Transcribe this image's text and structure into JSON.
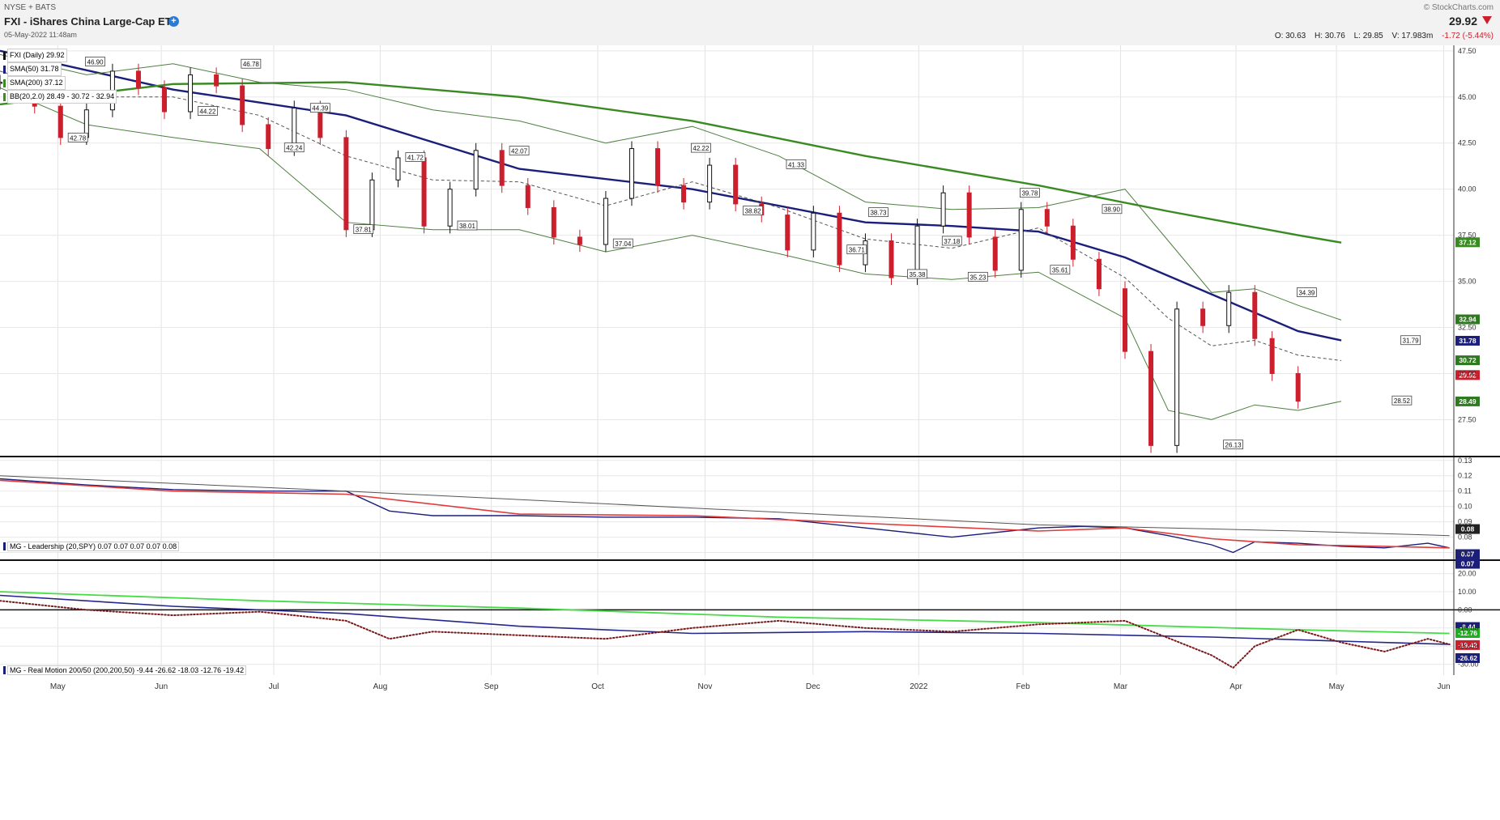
{
  "header": {
    "exchange": "NYSE + BATS",
    "title": "FXI - iShares China Large-Cap ETF",
    "date": "05-May-2022 11:48am",
    "watermark": "© StockCharts.com",
    "last": "29.92",
    "open": "O: 30.63",
    "high": "H: 30.76",
    "low": "L: 29.85",
    "volume": "V: 17.983m",
    "change": "-1.72 (-5.44%)"
  },
  "legend": {
    "price": "FXI (Daily) 29.92",
    "sma50": "SMA(50) 31.78",
    "sma200": "SMA(200) 37.12",
    "bb": "BB(20,2.0) 28.49 - 30.72 - 32.94"
  },
  "panel2": {
    "label": "MG - Leadership (20,SPY) 0.07 0.07 0.07 0.07 0.08"
  },
  "panel3": {
    "label": "MG - Real Motion 200/50 (200,200,50) -9.44 -26.62 -18.03 -12.76 -19.42"
  },
  "x_axis": {
    "months": [
      "May",
      "Jun",
      "Jul",
      "Aug",
      "Sep",
      "Oct",
      "Nov",
      "Dec",
      "2022",
      "Feb",
      "Mar",
      "Apr",
      "May",
      "Jun"
    ]
  },
  "colors": {
    "price_up": "#111111",
    "price_down": "#cc1f2d",
    "sma50": "#1b1f7a",
    "sma200": "#3a8a23",
    "bollinger": "#4d7f3f",
    "bb_mid": "#555555",
    "leadership": "#1b1f7a",
    "leadership_ma": "#e23b3b",
    "rm_green": "#44dd44",
    "rm_blue": "#23268a",
    "rm_dots": "#7a1a1a"
  },
  "chart_data": [
    {
      "type": "line",
      "title": "FXI - iShares China Large-Cap ETF",
      "y_ticks": [
        27.5,
        30.0,
        32.5,
        35.0,
        37.5,
        40.0,
        42.5,
        45.0,
        47.5
      ],
      "ylim": [
        25.5,
        47.8
      ],
      "x_ticks": [
        "May",
        "Jun",
        "Jul",
        "Aug",
        "Sep",
        "Oct",
        "Nov",
        "Dec",
        "2022",
        "Feb",
        "Mar",
        "Apr",
        "May",
        "Jun"
      ],
      "series": [
        {
          "name": "FXI (Daily)",
          "x_index": [
            0,
            8,
            14,
            20,
            26,
            32,
            38,
            44,
            50,
            56,
            62,
            68,
            74,
            80,
            86,
            92,
            98,
            104,
            110,
            116,
            122,
            128,
            134,
            140,
            146,
            152,
            158,
            164,
            170,
            176,
            182,
            188,
            194,
            200,
            206,
            212,
            218,
            224,
            230,
            236,
            242,
            248,
            254,
            260,
            266,
            272,
            278,
            284,
            290,
            294,
            300
          ],
          "values": [
            45.8,
            44.5,
            42.8,
            44.3,
            46.4,
            45.5,
            44.2,
            46.2,
            45.6,
            43.5,
            42.2,
            44.4,
            42.8,
            37.8,
            40.5,
            41.7,
            38.0,
            40.0,
            42.1,
            40.2,
            39.0,
            37.4,
            37.0,
            39.5,
            42.2,
            40.2,
            39.3,
            41.3,
            39.2,
            38.6,
            36.7,
            38.7,
            35.9,
            37.2,
            35.2,
            38.0,
            39.8,
            37.4,
            35.6,
            38.9,
            38.0,
            36.2,
            34.6,
            31.2,
            26.1,
            33.5,
            32.6,
            34.4,
            31.9,
            30.0,
            28.5
          ]
        },
        {
          "name": "SMA(50)",
          "x_index": [
            0,
            40,
            80,
            120,
            160,
            200,
            220,
            240,
            260,
            280,
            300,
            310
          ],
          "values": [
            47.5,
            45.4,
            44.0,
            41.1,
            40.0,
            38.2,
            38.0,
            37.7,
            36.3,
            34.3,
            32.3,
            31.8
          ]
        },
        {
          "name": "SMA(200)",
          "x_index": [
            0,
            40,
            80,
            120,
            160,
            200,
            240,
            270,
            300,
            310
          ],
          "values": [
            44.6,
            45.7,
            45.8,
            45.0,
            43.7,
            41.8,
            40.2,
            38.8,
            37.5,
            37.1
          ]
        },
        {
          "name": "BB upper",
          "x_index": [
            0,
            20,
            40,
            60,
            80,
            100,
            120,
            140,
            160,
            180,
            200,
            220,
            240,
            260,
            270,
            280,
            290,
            300,
            310
          ],
          "values": [
            47.3,
            46.2,
            46.8,
            45.8,
            45.4,
            44.3,
            43.7,
            42.5,
            43.4,
            41.8,
            39.3,
            38.9,
            39.0,
            40.0,
            37.2,
            34.4,
            34.6,
            33.7,
            32.9
          ]
        },
        {
          "name": "BB lower",
          "x_index": [
            0,
            20,
            40,
            60,
            80,
            100,
            120,
            140,
            160,
            180,
            200,
            220,
            240,
            260,
            270,
            280,
            290,
            300,
            310
          ],
          "values": [
            45.5,
            43.5,
            42.8,
            42.2,
            38.2,
            37.8,
            37.8,
            36.6,
            37.5,
            36.5,
            35.4,
            35.1,
            35.5,
            33.0,
            28.0,
            27.5,
            28.3,
            28.0,
            28.5
          ]
        },
        {
          "name": "BB mid",
          "x_index": [
            0,
            20,
            40,
            60,
            80,
            100,
            120,
            140,
            160,
            180,
            200,
            220,
            240,
            260,
            270,
            280,
            290,
            300,
            310
          ],
          "values": [
            46.4,
            45.0,
            45.0,
            44.0,
            41.8,
            40.5,
            40.4,
            39.1,
            40.4,
            39.0,
            37.3,
            36.8,
            37.9,
            35.2,
            33.0,
            31.5,
            31.8,
            31.0,
            30.7
          ]
        }
      ],
      "annotations": [
        {
          "x_index": 22,
          "value": 46.9,
          "label": "46.90"
        },
        {
          "x_index": 58,
          "value": 46.78,
          "label": "46.78"
        },
        {
          "x_index": 74,
          "value": 44.39,
          "label": "44.39"
        },
        {
          "x_index": 18,
          "value": 42.78,
          "label": "42.78"
        },
        {
          "x_index": 48,
          "value": 44.22,
          "label": "44.22"
        },
        {
          "x_index": 68,
          "value": 42.24,
          "label": "42.24"
        },
        {
          "x_index": 96,
          "value": 41.72,
          "label": "41.72"
        },
        {
          "x_index": 84,
          "value": 37.81,
          "label": "37.81"
        },
        {
          "x_index": 108,
          "value": 38.01,
          "label": "38.01"
        },
        {
          "x_index": 120,
          "value": 42.07,
          "label": "42.07"
        },
        {
          "x_index": 144,
          "value": 37.04,
          "label": "37.04"
        },
        {
          "x_index": 162,
          "value": 42.22,
          "label": "42.22"
        },
        {
          "x_index": 174,
          "value": 38.82,
          "label": "38.82"
        },
        {
          "x_index": 184,
          "value": 41.33,
          "label": "41.33"
        },
        {
          "x_index": 203,
          "value": 38.73,
          "label": "38.73"
        },
        {
          "x_index": 198,
          "value": 36.71,
          "label": "36.71"
        },
        {
          "x_index": 212,
          "value": 35.38,
          "label": "35.38"
        },
        {
          "x_index": 220,
          "value": 37.18,
          "label": "37.18"
        },
        {
          "x_index": 226,
          "value": 35.23,
          "label": "35.23"
        },
        {
          "x_index": 238,
          "value": 39.78,
          "label": "39.78"
        },
        {
          "x_index": 257,
          "value": 38.9,
          "label": "38.90"
        },
        {
          "x_index": 245,
          "value": 35.61,
          "label": "35.61"
        },
        {
          "x_index": 285,
          "value": 26.13,
          "label": "26.13"
        },
        {
          "x_index": 302,
          "value": 34.39,
          "label": "34.39"
        },
        {
          "x_index": 326,
          "value": 31.79,
          "label": "31.79"
        },
        {
          "x_index": 324,
          "value": 28.52,
          "label": "28.52"
        }
      ],
      "right_axis_labels": [
        {
          "value": 37.12,
          "label": "37.12",
          "color": "#3a8a23"
        },
        {
          "value": 32.94,
          "label": "32.94",
          "color": "#2f7a20"
        },
        {
          "value": 31.78,
          "label": "31.78",
          "color": "#1b1f7a"
        },
        {
          "value": 30.72,
          "label": "30.72",
          "color": "#2f7a20"
        },
        {
          "value": 29.92,
          "label": "29.92",
          "color": "#cc1f2d"
        },
        {
          "value": 28.49,
          "label": "28.49",
          "color": "#2f7a20"
        }
      ]
    },
    {
      "type": "line",
      "title": "MG - Leadership (20,SPY)",
      "y_ticks": [
        0.07,
        0.08,
        0.09,
        0.1,
        0.11,
        0.12,
        0.13
      ],
      "ylim": [
        0.065,
        0.132
      ],
      "series": [
        {
          "name": "Leadership",
          "x_index": [
            0,
            20,
            40,
            60,
            80,
            90,
            100,
            120,
            140,
            160,
            180,
            200,
            220,
            240,
            250,
            260,
            270,
            280,
            285,
            290,
            300,
            310,
            320,
            330,
            335
          ],
          "values": [
            0.118,
            0.114,
            0.111,
            0.11,
            0.11,
            0.097,
            0.094,
            0.094,
            0.093,
            0.093,
            0.092,
            0.086,
            0.08,
            0.086,
            0.087,
            0.086,
            0.081,
            0.075,
            0.07,
            0.077,
            0.076,
            0.074,
            0.073,
            0.076,
            0.073
          ]
        },
        {
          "name": "MA",
          "x_index": [
            0,
            40,
            80,
            120,
            160,
            200,
            240,
            260,
            280,
            300,
            320,
            335
          ],
          "values": [
            0.117,
            0.11,
            0.108,
            0.095,
            0.094,
            0.089,
            0.084,
            0.086,
            0.079,
            0.075,
            0.074,
            0.073
          ]
        },
        {
          "name": "Long MA",
          "x_index": [
            0,
            80,
            160,
            240,
            300,
            335
          ],
          "values": [
            0.12,
            0.11,
            0.099,
            0.088,
            0.084,
            0.081
          ]
        }
      ],
      "right_axis_labels": [
        {
          "value": 0.08,
          "label": "0.08"
        },
        {
          "value": 0.07,
          "label": "0.07"
        },
        {
          "value": 0.07,
          "label": "0.07"
        }
      ]
    },
    {
      "type": "line",
      "title": "MG - Real Motion 200/50",
      "y_ticks": [
        -30.0,
        -20.0,
        -10.0,
        0.0,
        10.0,
        20.0
      ],
      "ylim": [
        -36,
        27
      ],
      "series": [
        {
          "name": "Green",
          "x_index": [
            0,
            60,
            120,
            180,
            240,
            300,
            335
          ],
          "values": [
            10,
            5,
            1,
            -4,
            -7,
            -11,
            -13
          ]
        },
        {
          "name": "Blue",
          "x_index": [
            0,
            40,
            80,
            120,
            160,
            200,
            240,
            280,
            320,
            335
          ],
          "values": [
            8,
            2,
            -2,
            -9,
            -13,
            -12,
            -13,
            -15,
            -18,
            -19
          ]
        },
        {
          "name": "Dots",
          "x_index": [
            0,
            20,
            40,
            60,
            80,
            90,
            100,
            120,
            140,
            160,
            180,
            200,
            220,
            240,
            260,
            280,
            285,
            290,
            300,
            310,
            320,
            330,
            335
          ],
          "values": [
            5,
            0,
            -3,
            -1,
            -6,
            -16,
            -12,
            -14,
            -16,
            -10,
            -6,
            -10,
            -12,
            -8,
            -6,
            -25,
            -32,
            -20,
            -11,
            -18,
            -23,
            -16,
            -19
          ]
        }
      ],
      "right_axis_labels": [
        {
          "value": -9.44,
          "label": "-9.44"
        },
        {
          "value": -12.76,
          "label": "-12.76"
        },
        {
          "value": -19.42,
          "label": "-19.42"
        },
        {
          "value": -26.62,
          "label": "-26.62"
        }
      ]
    }
  ]
}
